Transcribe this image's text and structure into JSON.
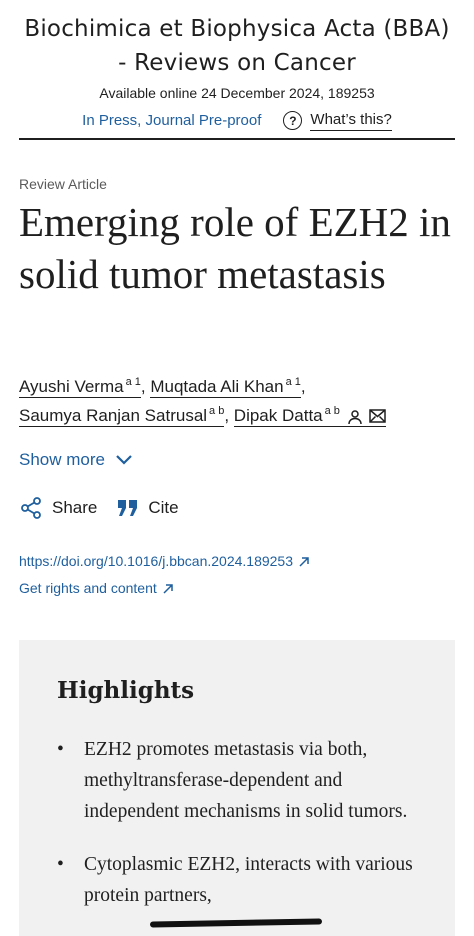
{
  "journal": {
    "title": "Biochimica et Biophysica Acta (BBA) - Reviews on Cancer",
    "available": "Available online 24 December 2024, 189253",
    "in_press": "In Press, Journal Pre-proof",
    "whats_this": "What’s this?"
  },
  "article": {
    "type": "Review Article",
    "title": "Emerging role of EZH2 in solid tumor metastasis"
  },
  "authors": [
    {
      "name": "Ayushi Verma",
      "affil": "a 1"
    },
    {
      "name": "Muqtada Ali Khan",
      "affil": "a 1"
    },
    {
      "name": "Saumya Ranjan Satrusal",
      "affil": "a b"
    },
    {
      "name": "Dipak Datta",
      "affil": "a b"
    }
  ],
  "show_more": "Show more",
  "actions": {
    "share": "Share",
    "cite": "Cite"
  },
  "links": {
    "doi": "https://doi.org/10.1016/j.bbcan.2024.189253",
    "rights": "Get rights and content"
  },
  "highlights": {
    "title": "Highlights",
    "items": [
      "EZH2 promotes metastasis via both, methyltransferase-dependent and independent mechanisms in solid tumors.",
      "Cytoplasmic EZH2, interacts with various protein partners,"
    ]
  },
  "colors": {
    "link": "#1f5f9e",
    "text": "#1f1f1f",
    "box": "#f1f1f1"
  }
}
